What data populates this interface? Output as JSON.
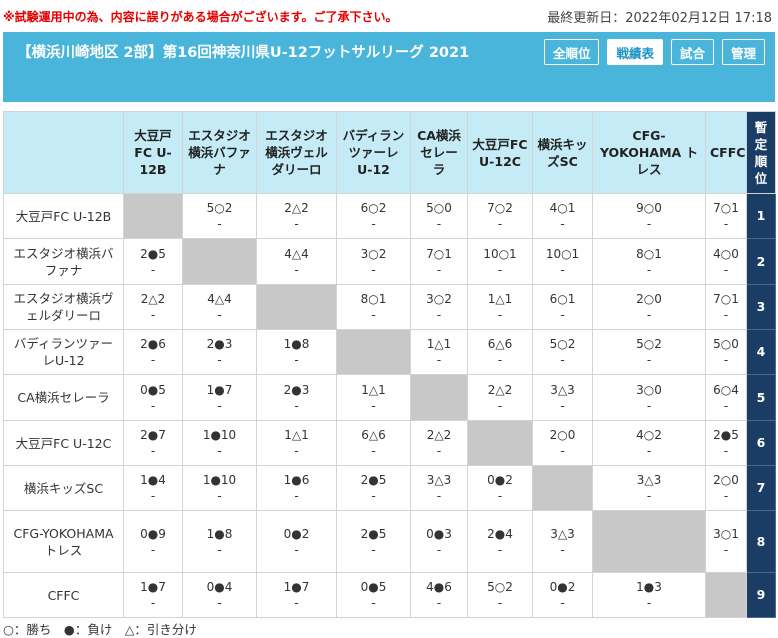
{
  "notice": "※試験運用中の為、内容に誤りがある場合がございます。ご了承下さい。",
  "last_updated": "最終更新日：2022年02月12日 17:18",
  "title": "【横浜川崎地区 2部】第16回神奈川県U-12フットサルリーグ 2021",
  "nav": {
    "overall": "全順位",
    "results": "戦績表",
    "matches": "試合",
    "admin": "管理"
  },
  "columns": [
    "大豆戸FC U-12B",
    "エスタジオ横浜バファナ",
    "エスタジオ横浜ヴェルダリーロ",
    "バディランツァーレU-12",
    "CA横浜セレーラ",
    "大豆戸FC U-12C",
    "横浜キッズSC",
    "CFG-YOKOHAMA トレス",
    "CFFC"
  ],
  "rank_header": "暫定順位",
  "rows": [
    {
      "name": "大豆戸FC U-12B",
      "rank": "1",
      "cells": [
        null,
        "5○2",
        "2△2",
        "6○2",
        "5○0",
        "7○2",
        "4○1",
        "9○0",
        "7○1"
      ]
    },
    {
      "name": "エスタジオ横浜バファナ",
      "rank": "2",
      "cells": [
        "2●5",
        null,
        "4△4",
        "3○2",
        "7○1",
        "10○1",
        "10○1",
        "8○1",
        "4○0"
      ]
    },
    {
      "name": "エスタジオ横浜ヴェルダリーロ",
      "rank": "3",
      "cells": [
        "2△2",
        "4△4",
        null,
        "8○1",
        "3○2",
        "1△1",
        "6○1",
        "2○0",
        "7○1"
      ]
    },
    {
      "name": "バディランツァーレU-12",
      "rank": "4",
      "cells": [
        "2●6",
        "2●3",
        "1●8",
        null,
        "1△1",
        "6△6",
        "5○2",
        "5○2",
        "5○0"
      ]
    },
    {
      "name": "CA横浜セレーラ",
      "rank": "5",
      "cells": [
        "0●5",
        "1●7",
        "2●3",
        "1△1",
        null,
        "2△2",
        "3△3",
        "3○0",
        "6○4"
      ]
    },
    {
      "name": "大豆戸FC U-12C",
      "rank": "6",
      "cells": [
        "2●7",
        "1●10",
        "1△1",
        "6△6",
        "2△2",
        null,
        "2○0",
        "4○2",
        "2●5"
      ]
    },
    {
      "name": "横浜キッズSC",
      "rank": "7",
      "cells": [
        "1●4",
        "1●10",
        "1●6",
        "2●5",
        "3△3",
        "0●2",
        null,
        "3△3",
        "2○0"
      ]
    },
    {
      "name": "CFG-YOKOHAMA トレス",
      "rank": "8",
      "cells": [
        "0●9",
        "1●8",
        "0●2",
        "2●5",
        "0●3",
        "2●4",
        "3△3",
        null,
        "3○1"
      ]
    },
    {
      "name": "CFFC",
      "rank": "9",
      "cells": [
        "1●7",
        "0●4",
        "1●7",
        "0●5",
        "4●6",
        "5○2",
        "0●2",
        "1●3",
        null
      ]
    }
  ],
  "placeholder_dash": "-",
  "legend": "○：勝ち　●：負け　△：引き分け"
}
